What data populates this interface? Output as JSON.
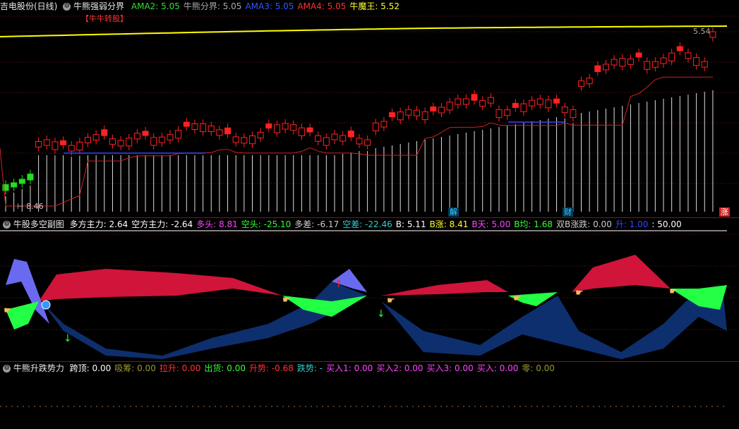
{
  "panel1": {
    "name": "吉电股份(日线)",
    "indicator": "牛熊强弱分界",
    "items": [
      {
        "label": "AMA2: ",
        "value": "5.05",
        "color": "#33dd33"
      },
      {
        "label": "牛熊分界: ",
        "value": "5.05",
        "color": "#aaaaaa"
      },
      {
        "label": "AMA3: ",
        "value": "5.05",
        "color": "#3355ff"
      },
      {
        "label": "AMA4: ",
        "value": "5.05",
        "color": "#ff3030"
      },
      {
        "label": "牛魔王: ",
        "value": "5.52",
        "color": "#ffff33"
      }
    ],
    "annotation_top": "【牛牛转股】",
    "price_high": "5.54",
    "price_low": "8.46",
    "tags": [
      {
        "text": "解",
        "color": "#33ccff",
        "bg": "#073a5a"
      },
      {
        "text": "财",
        "color": "#33ccff",
        "bg": "#073a5a"
      },
      {
        "text": "涨",
        "color": "#ffffff",
        "bg": "#cc2222"
      }
    ]
  },
  "panel2": {
    "indicator": "牛股多空副图",
    "items": [
      {
        "label": "多方主力: ",
        "value": "2.64",
        "color": "#ffffff"
      },
      {
        "label": "空方主力: ",
        "value": "-2.64",
        "color": "#ffffff"
      },
      {
        "label": "多头: ",
        "value": "8.81",
        "color": "#ff44ff"
      },
      {
        "label": "空头: ",
        "value": "-25.10",
        "color": "#33ff33"
      },
      {
        "label": "多差: ",
        "value": "-6.17",
        "color": "#cccccc"
      },
      {
        "label": "空差: ",
        "value": "-22.46",
        "color": "#33cccc"
      },
      {
        "label": "B: ",
        "value": "5.11",
        "color": "#ffffff"
      },
      {
        "label": "B涨: ",
        "value": "8.41",
        "color": "#ffff33"
      },
      {
        "label": "B天: ",
        "value": "5.00",
        "color": "#ff44ff"
      },
      {
        "label": "B均: ",
        "value": "1.68",
        "color": "#33ff33"
      },
      {
        "label": "双B涨跌: ",
        "value": "0.00",
        "color": "#cccccc"
      },
      {
        "label": "升: ",
        "value": "1.00",
        "color": "#3344ff"
      },
      {
        "label": ": ",
        "value": "50.00",
        "color": "#ffffff"
      }
    ]
  },
  "panel3": {
    "indicator": "牛熊升跌势力",
    "items": [
      {
        "label": "跨顶: ",
        "value": "0.00",
        "color": "#ffffff"
      },
      {
        "label": "吸筹: ",
        "value": "0.00",
        "color": "#999933"
      },
      {
        "label": "拉升: ",
        "value": "0.00",
        "color": "#ff3333"
      },
      {
        "label": "出货: ",
        "value": "0.00",
        "color": "#33ff33"
      },
      {
        "label": "升势: ",
        "value": "-0.68",
        "color": "#ff3333"
      },
      {
        "label": "跌势: ",
        "value": "-",
        "color": "#33cccc"
      },
      {
        "label": "买入1: ",
        "value": "0.00",
        "color": "#ff44ff"
      },
      {
        "label": "买入2: ",
        "value": "0.00",
        "color": "#ff44ff"
      },
      {
        "label": "买入3: ",
        "value": "0.00",
        "color": "#ff44ff"
      },
      {
        "label": "买入: ",
        "value": "0.00",
        "color": "#ff44ff"
      },
      {
        "label": "零: ",
        "value": "0.00",
        "color": "#999933"
      }
    ]
  },
  "colors": {
    "up": "#ff2222",
    "down": "#22dd22",
    "bull": "#d0143a",
    "bear": "#0e2f6e",
    "green_fill": "#22ff44",
    "violet": "#6a6af0",
    "yellow": "#ffff00"
  }
}
